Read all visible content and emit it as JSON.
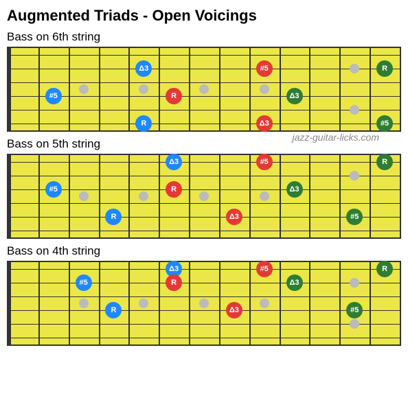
{
  "title": "Augmented Triads - Open Voicings",
  "watermark": "jazz-guitar-licks.com",
  "diagrams": [
    {
      "subtitle": "Bass on 6th string",
      "notes": [
        {
          "fret": 2,
          "string": 4,
          "color": "blue",
          "label": "#5"
        },
        {
          "fret": 5,
          "string": 2,
          "color": "blue",
          "label": "Δ3"
        },
        {
          "fret": 5,
          "string": 6,
          "color": "blue",
          "label": "R"
        },
        {
          "fret": 6,
          "string": 4,
          "color": "red",
          "label": "R"
        },
        {
          "fret": 9,
          "string": 2,
          "color": "red",
          "label": "#5"
        },
        {
          "fret": 9,
          "string": 6,
          "color": "red",
          "label": "Δ3"
        },
        {
          "fret": 10,
          "string": 4,
          "color": "green",
          "label": "Δ3"
        },
        {
          "fret": 13,
          "string": 2,
          "color": "green",
          "label": "R"
        },
        {
          "fret": 13,
          "string": 6,
          "color": "green",
          "label": "#5"
        }
      ]
    },
    {
      "subtitle": "Bass on 5th string",
      "notes": [
        {
          "fret": 2,
          "string": 3,
          "color": "blue",
          "label": "#5"
        },
        {
          "fret": 4,
          "string": 5,
          "color": "blue",
          "label": "R"
        },
        {
          "fret": 6,
          "string": 1,
          "color": "blue",
          "label": "Δ3"
        },
        {
          "fret": 6,
          "string": 3,
          "color": "red",
          "label": "R"
        },
        {
          "fret": 8,
          "string": 5,
          "color": "red",
          "label": "Δ3"
        },
        {
          "fret": 9,
          "string": 1,
          "color": "red",
          "label": "#5"
        },
        {
          "fret": 10,
          "string": 3,
          "color": "green",
          "label": "Δ3"
        },
        {
          "fret": 12,
          "string": 5,
          "color": "green",
          "label": "#5"
        },
        {
          "fret": 13,
          "string": 1,
          "color": "green",
          "label": "R"
        }
      ]
    },
    {
      "subtitle": "Bass on 4th string",
      "notes": [
        {
          "fret": 3,
          "string": 2,
          "color": "blue",
          "label": "#5"
        },
        {
          "fret": 4,
          "string": 4,
          "color": "blue",
          "label": "R"
        },
        {
          "fret": 6,
          "string": 1,
          "color": "blue",
          "label": "Δ3"
        },
        {
          "fret": 6,
          "string": 2,
          "color": "red",
          "label": "R"
        },
        {
          "fret": 8,
          "string": 4,
          "color": "red",
          "label": "Δ3"
        },
        {
          "fret": 9,
          "string": 1,
          "color": "red",
          "label": "#5"
        },
        {
          "fret": 10,
          "string": 2,
          "color": "green",
          "label": "Δ3"
        },
        {
          "fret": 12,
          "string": 4,
          "color": "green",
          "label": "#5"
        },
        {
          "fret": 13,
          "string": 1,
          "color": "green",
          "label": "R"
        }
      ]
    }
  ]
}
